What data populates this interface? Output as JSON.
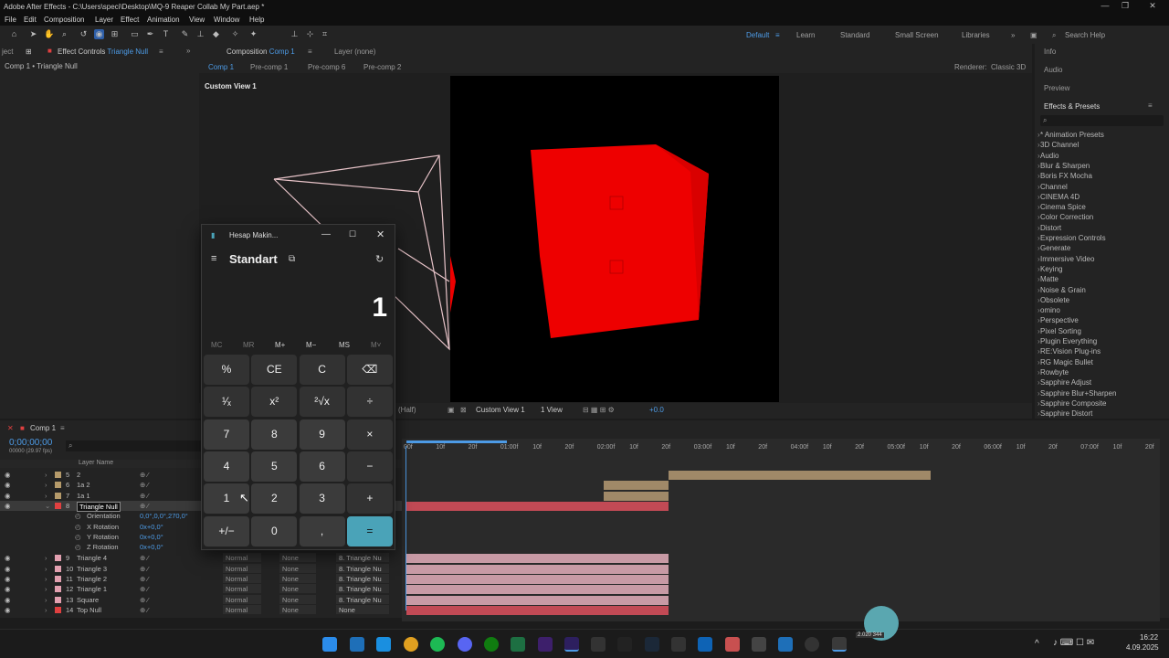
{
  "window": {
    "title": "Adobe After Effects - C:\\Users\\speci\\Desktop\\MQ-9 Reaper Collab My Part.aep *"
  },
  "menu": [
    "File",
    "Edit",
    "Composition",
    "Layer",
    "Effect",
    "Animation",
    "View",
    "Window",
    "Help"
  ],
  "workspaces": [
    "Default",
    "Learn",
    "Standard",
    "Small Screen",
    "Libraries"
  ],
  "search_help": "Search Help",
  "left_panel": {
    "tab_project": "ject",
    "tab_effect_controls": "Effect Controls",
    "effect_target": "Triangle Null",
    "breadcrumb": "Comp 1 • Triangle Null"
  },
  "viewer": {
    "tab_comp": "Composition",
    "comp_name": "Comp 1",
    "layer_tab": "Layer (none)",
    "nav": [
      "Comp 1",
      "Pre-comp 1",
      "Pre-comp 6",
      "Pre-comp 2"
    ],
    "renderer_label": "Renderer:",
    "renderer_value": "Classic 3D",
    "view_label": "Custom View 1",
    "resolution": "(Half)",
    "view_select": "Custom View 1",
    "views": "1 View",
    "exposure": "+0.0"
  },
  "right_panel": {
    "info": "Info",
    "audio": "Audio",
    "preview": "Preview",
    "effects_presets": "Effects & Presets",
    "search_placeholder": "",
    "items": [
      "* Animation Presets",
      "3D Channel",
      "Audio",
      "Blur & Sharpen",
      "Boris FX Mocha",
      "Channel",
      "CINEMA 4D",
      "Cinema Spice",
      "Color Correction",
      "Distort",
      "Expression Controls",
      "Generate",
      "Immersive Video",
      "Keying",
      "Matte",
      "Noise & Grain",
      "Obsolete",
      "omino",
      "Perspective",
      "Pixel Sorting",
      "Plugin Everything",
      "RE:Vision Plug-ins",
      "RG Magic Bullet",
      "Rowbyte",
      "Sapphire Adjust",
      "Sapphire Blur+Sharpen",
      "Sapphire Composite",
      "Sapphire Distort"
    ]
  },
  "timeline": {
    "comp_tab": "Comp 1",
    "timecode": "0;00;00;00",
    "fps": "00000 (29.97 fps)",
    "layer_name_header": "Layer Name",
    "ruler": [
      "00f",
      "10f",
      "20f",
      "01:00f",
      "10f",
      "20f",
      "02:00f",
      "10f",
      "20f",
      "03:00f",
      "10f",
      "20f",
      "04:00f",
      "10f",
      "20f",
      "05:00f",
      "10f",
      "20f",
      "06:00f",
      "10f",
      "20f",
      "07:00f",
      "10f",
      "20f"
    ],
    "layers": [
      {
        "num": "5",
        "name": "2",
        "color": "#b59a6a"
      },
      {
        "num": "6",
        "name": "1a 2",
        "color": "#b59a6a"
      },
      {
        "num": "7",
        "name": "1a 1",
        "color": "#b59a6a"
      },
      {
        "num": "8",
        "name": "Triangle Null",
        "color": "#e04040",
        "selected": true
      }
    ],
    "props": [
      {
        "name": "Orientation",
        "value": "0,0°,0,0°,270,0°"
      },
      {
        "name": "X Rotation",
        "value": "0x+0,0°"
      },
      {
        "name": "Y Rotation",
        "value": "0x+0,0°"
      },
      {
        "name": "Z Rotation",
        "value": "0x+0,0°"
      }
    ],
    "layers2": [
      {
        "num": "9",
        "name": "Triangle 4",
        "color": "#e2a0b0",
        "mode": "Normal",
        "trk": "None",
        "parent": "8. Triangle Nu"
      },
      {
        "num": "10",
        "name": "Triangle 3",
        "color": "#e2a0b0",
        "mode": "Normal",
        "trk": "None",
        "parent": "8. Triangle Nu"
      },
      {
        "num": "11",
        "name": "Triangle 2",
        "color": "#e2a0b0",
        "mode": "Normal",
        "trk": "None",
        "parent": "8. Triangle Nu"
      },
      {
        "num": "12",
        "name": "Triangle 1",
        "color": "#e2a0b0",
        "mode": "Normal",
        "trk": "None",
        "parent": "8. Triangle Nu"
      },
      {
        "num": "13",
        "name": "Square",
        "color": "#e2a0b0",
        "mode": "Normal",
        "trk": "None",
        "parent": "8. Triangle Nu"
      },
      {
        "num": "14",
        "name": "Top Null",
        "color": "#e04040",
        "mode": "Normal",
        "trk": "None",
        "parent": "None"
      }
    ]
  },
  "calculator": {
    "title": "Hesap Makin...",
    "mode": "Standart",
    "display": "1",
    "memory": [
      "MC",
      "MR",
      "M+",
      "M−",
      "MS",
      "M˅"
    ],
    "buttons": [
      [
        "%",
        "CE",
        "C",
        "⌫"
      ],
      [
        "¹⁄ₓ",
        "x²",
        "²√x",
        "÷"
      ],
      [
        "7",
        "8",
        "9",
        "×"
      ],
      [
        "4",
        "5",
        "6",
        "−"
      ],
      [
        "1",
        "2",
        "3",
        "+"
      ],
      [
        "+/−",
        "0",
        ",",
        "="
      ]
    ]
  },
  "taskbar": {
    "time": "16:22",
    "date": "4.09.2025",
    "widget": "2.020 344"
  }
}
